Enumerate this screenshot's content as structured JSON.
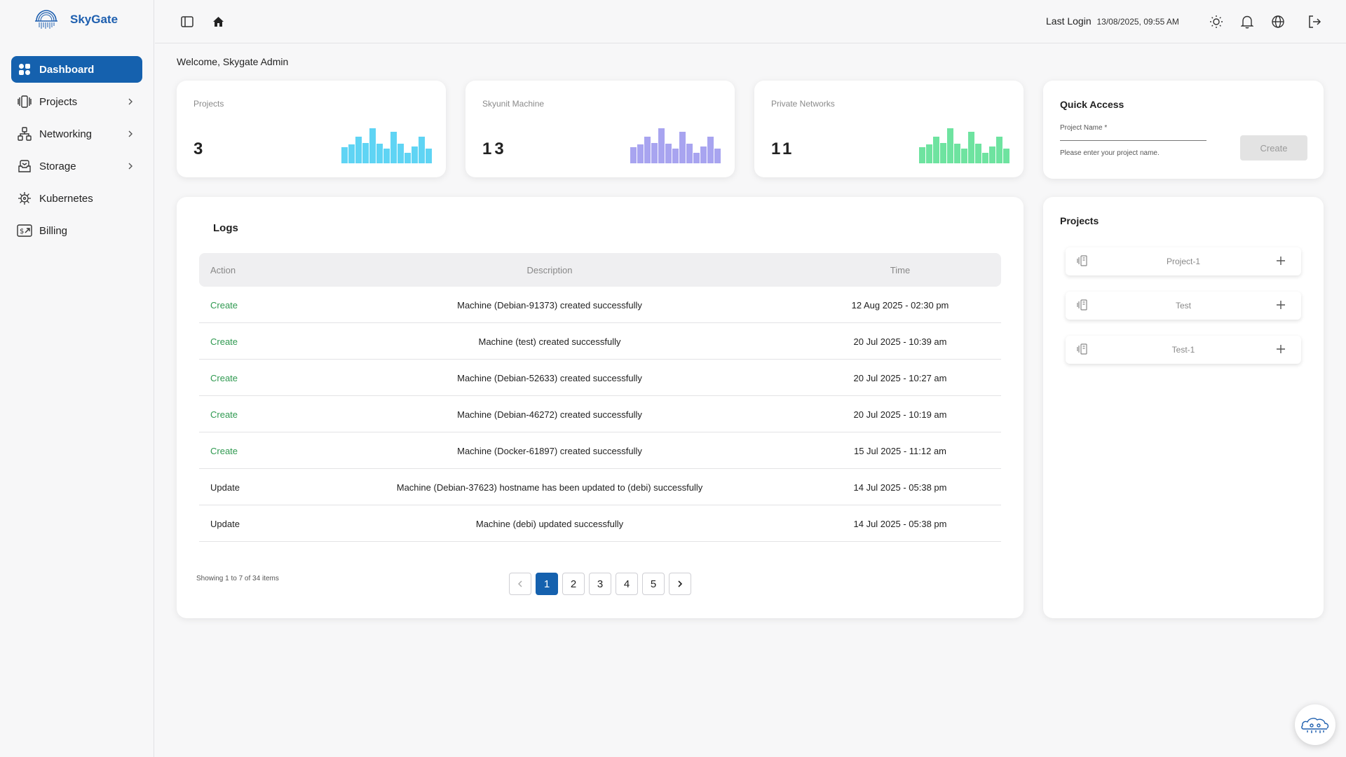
{
  "brand": {
    "name": "SkyGate"
  },
  "sidebar": {
    "items": [
      {
        "label": "Dashboard",
        "icon": "dashboard-icon",
        "active": true
      },
      {
        "label": "Projects",
        "icon": "projects-icon"
      },
      {
        "label": "Networking",
        "icon": "networking-icon"
      },
      {
        "label": "Storage",
        "icon": "storage-icon"
      },
      {
        "label": "Kubernetes",
        "icon": "kubernetes-icon"
      },
      {
        "label": "Billing",
        "icon": "billing-icon"
      }
    ]
  },
  "header": {
    "last_login_label": "Last Login",
    "last_login_value": "13/08/2025, 09:55 AM"
  },
  "welcome": "Welcome, Skygate Admin",
  "stats": [
    {
      "title": "Projects",
      "value": "3",
      "color": "#5fd4f4"
    },
    {
      "title": "Skyunit Machine",
      "value": "13",
      "color": "#a8a4f0"
    },
    {
      "title": "Private Networks",
      "value": "11",
      "color": "#6ee3a0"
    }
  ],
  "quick_access": {
    "title": "Quick Access",
    "label": "Project Name *",
    "value": "",
    "helper": "Please enter your project name.",
    "button": "Create"
  },
  "logs": {
    "title": "Logs",
    "columns": [
      "Action",
      "Description",
      "Time"
    ],
    "rows": [
      {
        "action": "Create",
        "description": "Machine (Debian-91373) created successfully",
        "time": "12 Aug 2025 - 02:30 pm"
      },
      {
        "action": "Create",
        "description": "Machine (test) created successfully",
        "time": "20 Jul 2025 - 10:39 am"
      },
      {
        "action": "Create",
        "description": "Machine (Debian-52633) created successfully",
        "time": "20 Jul 2025 - 10:27 am"
      },
      {
        "action": "Create",
        "description": "Machine (Debian-46272) created successfully",
        "time": "20 Jul 2025 - 10:19 am"
      },
      {
        "action": "Create",
        "description": "Machine (Docker-61897) created successfully",
        "time": "15 Jul 2025 - 11:12 am"
      },
      {
        "action": "Update",
        "description": "Machine (Debian-37623) hostname has been updated to (debi) successfully",
        "time": "14 Jul 2025 - 05:38 pm"
      },
      {
        "action": "Update",
        "description": "Machine (debi) updated successfully",
        "time": "14 Jul 2025 - 05:38 pm"
      }
    ],
    "showing": "Showing 1 to 7 of 34 items",
    "pages": [
      "1",
      "2",
      "3",
      "4",
      "5"
    ],
    "current_page": "1"
  },
  "projects_panel": {
    "title": "Projects",
    "items": [
      "Project-1",
      "Test",
      "Test-1"
    ]
  },
  "colors": {
    "accent": "#1561ae",
    "create": "#2f9950"
  }
}
